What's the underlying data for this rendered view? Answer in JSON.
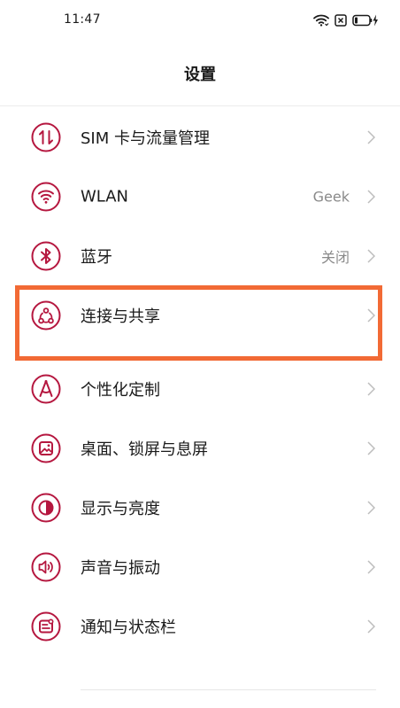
{
  "status_bar": {
    "time": "11:47"
  },
  "header": {
    "title": "设置"
  },
  "settings": {
    "items": [
      {
        "label": "SIM 卡与流量管理",
        "value": ""
      },
      {
        "label": "WLAN",
        "value": "Geek"
      },
      {
        "label": "蓝牙",
        "value": "关闭"
      },
      {
        "label": "连接与共享",
        "value": ""
      },
      {
        "label": "个性化定制",
        "value": ""
      },
      {
        "label": "桌面、锁屏与息屏",
        "value": ""
      },
      {
        "label": "显示与亮度",
        "value": ""
      },
      {
        "label": "声音与振动",
        "value": ""
      },
      {
        "label": "通知与状态栏",
        "value": ""
      }
    ]
  },
  "theme": {
    "icon_color": "#b5173f",
    "highlight_color": "#f26a35"
  }
}
